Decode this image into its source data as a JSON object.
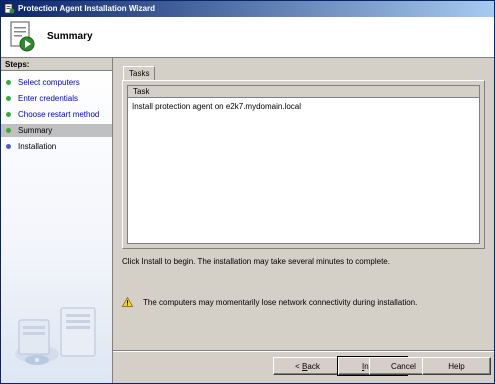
{
  "window": {
    "title": "Protection Agent Installation Wizard"
  },
  "header": {
    "title": "Summary"
  },
  "sidebar": {
    "heading": "Steps:",
    "steps": [
      {
        "label": "Select computers",
        "status": "done",
        "color": "#3aa83a"
      },
      {
        "label": "Enter credentials",
        "status": "done",
        "color": "#3aa83a"
      },
      {
        "label": "Choose restart method",
        "status": "done",
        "color": "#3aa83a"
      },
      {
        "label": "Summary",
        "status": "current",
        "color": "#3aa83a"
      },
      {
        "label": "Installation",
        "status": "pending",
        "color": "#4a5ec8"
      }
    ]
  },
  "tasks": {
    "tab_label": "Tasks",
    "column_header": "Task",
    "rows": [
      "Install protection agent on e2k7.mydomain.local"
    ]
  },
  "messages": {
    "info": "Click Install to begin. The installation may take several minutes to complete.",
    "warning": "The computers may momentarily lose network connectivity during installation."
  },
  "buttons": {
    "back": {
      "pre": "< ",
      "mnemonic": "B",
      "post": "ack"
    },
    "install": {
      "pre": "",
      "mnemonic": "I",
      "post": "nstall"
    },
    "cancel": "Cancel",
    "help": "Help"
  },
  "colors": {
    "link": "#0000cc",
    "titlebar_start": "#0a246a",
    "titlebar_end": "#a6caf0"
  }
}
